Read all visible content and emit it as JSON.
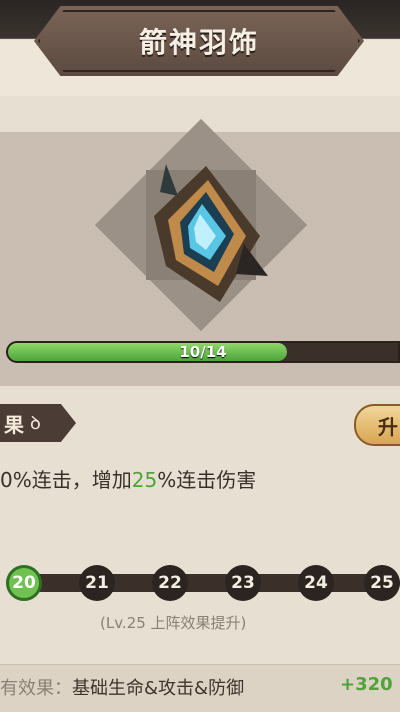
{
  "title": "箭神羽饰",
  "item": {
    "icon": "feather-gem-icon",
    "progress": {
      "current": 10,
      "max": 14,
      "label": "10/14"
    }
  },
  "effect": {
    "tab_label": "果",
    "upgrade_label": "升",
    "description": {
      "part1": "0%连击，增加",
      "highlight": "25",
      "part2": "%连击伤害"
    }
  },
  "levels": {
    "nodes": [
      "20",
      "21",
      "22",
      "23",
      "24",
      "25"
    ],
    "active": "20",
    "note": "(Lv.25 上阵效果提升)"
  },
  "bottom": {
    "label": "有效果：",
    "text": "基础生命&攻击&防御",
    "value": "+320"
  },
  "colors": {
    "accent_green": "#4ea339",
    "panel": "#c9beb1"
  }
}
